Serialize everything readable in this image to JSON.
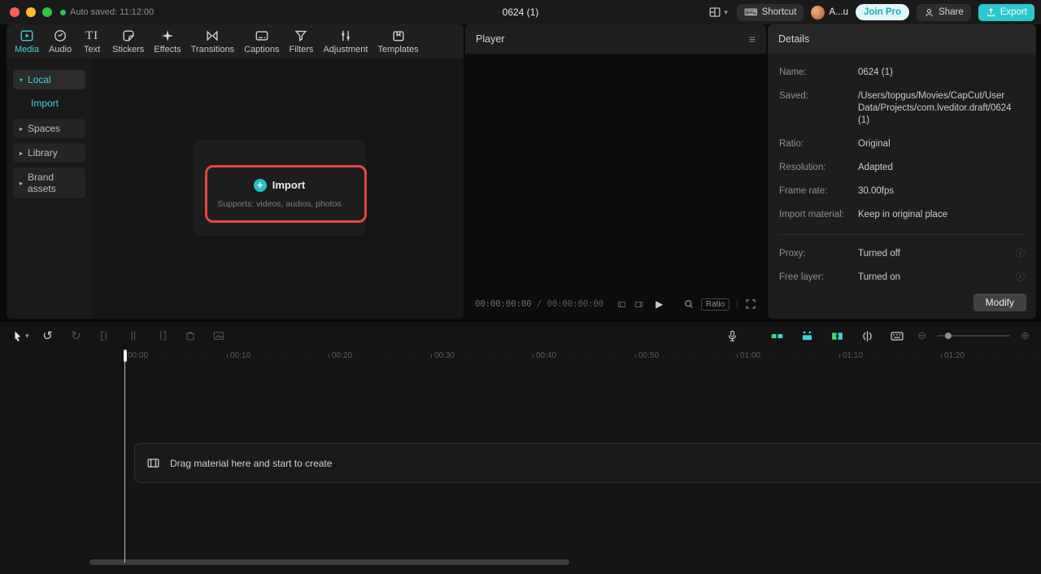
{
  "titlebar": {
    "auto_saved": "Auto saved: 11:12:00",
    "title": "0624 (1)",
    "shortcut_label": "Shortcut",
    "account_label": "A...u",
    "join_pro_label": "Join Pro",
    "share_label": "Share",
    "export_label": "Export"
  },
  "media_panel": {
    "tabs": [
      {
        "label": "Media"
      },
      {
        "label": "Audio"
      },
      {
        "label": "Text"
      },
      {
        "label": "Stickers"
      },
      {
        "label": "Effects"
      },
      {
        "label": "Transitions"
      },
      {
        "label": "Captions"
      },
      {
        "label": "Filters"
      },
      {
        "label": "Adjustment"
      },
      {
        "label": "Templates"
      }
    ],
    "sidebar": [
      {
        "label": "Local"
      },
      {
        "label": "Import"
      },
      {
        "label": "Spaces"
      },
      {
        "label": "Library"
      },
      {
        "label": "Brand assets"
      }
    ],
    "import_card": {
      "button_label": "Import",
      "hint": "Supports: videos, audios, photos"
    }
  },
  "player": {
    "title": "Player",
    "current_time": "00:00:00:00",
    "separator": "/",
    "total_time": "00:00:00:00",
    "ratio_label": "Ratio"
  },
  "details": {
    "title": "Details",
    "rows": [
      {
        "label": "Name:",
        "value": "0624 (1)"
      },
      {
        "label": "Saved:",
        "value": "/Users/topgus/Movies/CapCut/User Data/Projects/com.lveditor.draft/0624 (1)"
      },
      {
        "label": "Ratio:",
        "value": "Original"
      },
      {
        "label": "Resolution:",
        "value": "Adapted"
      },
      {
        "label": "Frame rate:",
        "value": "30.00fps"
      },
      {
        "label": "Import material:",
        "value": "Keep in original place"
      },
      {
        "label": "Proxy:",
        "value": "Turned off"
      },
      {
        "label": "Free layer:",
        "value": "Turned on"
      }
    ],
    "modify_label": "Modify"
  },
  "timeline": {
    "ruler": [
      "00:00",
      "00:10",
      "00:20",
      "00:30",
      "00:40",
      "00:50",
      "01:00",
      "01:10",
      "01:20"
    ],
    "drag_hint": "Drag material here and start to create"
  },
  "icons": {
    "menu": "≡",
    "play": "▶",
    "chevron_down": "▾",
    "arrow_collapsed": "▸",
    "arrow_expanded": "▾",
    "plus": "+",
    "info": "ⓘ",
    "undo": "↺",
    "redo": "↻",
    "keyboard": "⌨",
    "minus_circle": "⊖",
    "plus_circle": "⊕",
    "pipe": "|"
  },
  "colors": {
    "accent": "#3fd3d8",
    "highlight_red": "#e8453c",
    "join_pro_text": "#12aeb6",
    "export_bg": "#2cc7ce"
  }
}
